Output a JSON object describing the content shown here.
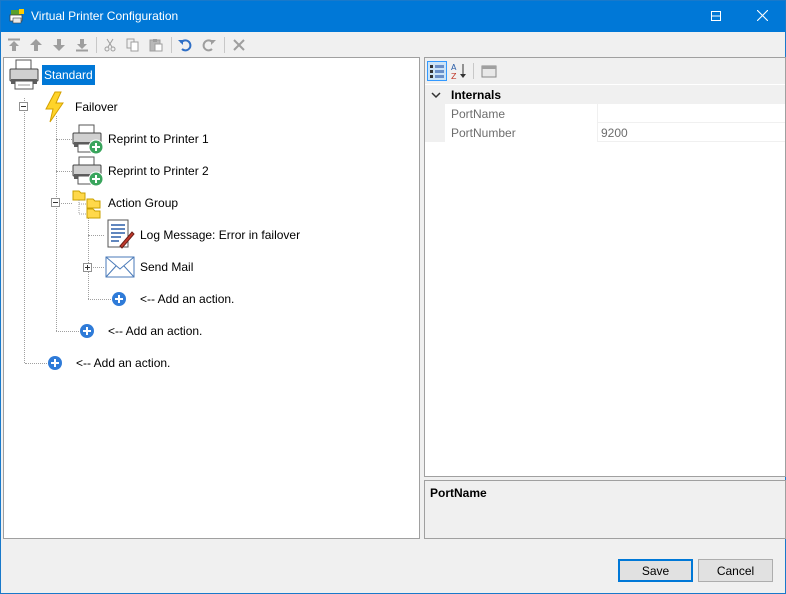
{
  "window": {
    "title": "Virtual Printer Configuration",
    "controls": [
      "minimize-icon",
      "maximize-icon",
      "close-icon"
    ]
  },
  "toolbar": {
    "items": [
      "move-top-icon",
      "move-up-icon",
      "move-down-icon",
      "move-bottom-icon",
      "cut-icon",
      "copy-icon",
      "paste-icon",
      "undo-icon",
      "redo-icon",
      "delete-icon"
    ]
  },
  "tree": {
    "root": {
      "label": "Standard",
      "icon": "printer-icon"
    },
    "failover": {
      "label": "Failover",
      "icon": "lightning-icon"
    },
    "reprint1": {
      "label": "Reprint to Printer 1",
      "icon": "printer-add-icon"
    },
    "reprint2": {
      "label": "Reprint to Printer 2",
      "icon": "printer-add-icon"
    },
    "action_group": {
      "label": "Action Group",
      "icon": "folders-icon"
    },
    "log_message": {
      "label": "Log Message: Error in failover",
      "icon": "log-document-icon"
    },
    "send_mail": {
      "label": "Send Mail",
      "icon": "envelope-icon"
    },
    "add_action_group": {
      "label": "<-- Add an action.",
      "icon": "add-circle-icon"
    },
    "add_action_failover": {
      "label": "<-- Add an action.",
      "icon": "add-circle-icon"
    },
    "add_action_root": {
      "label": "<-- Add an action.",
      "icon": "add-circle-icon"
    }
  },
  "properties": {
    "toolbar": [
      "categorized-icon",
      "alphabetical-icon",
      "property-pages-icon"
    ],
    "category": "Internals",
    "rows": [
      {
        "name": "PortName",
        "value": ""
      },
      {
        "name": "PortNumber",
        "value": "9200"
      }
    ],
    "description_title": "PortName"
  },
  "buttons": {
    "save": "Save",
    "cancel": "Cancel"
  },
  "colors": {
    "accent": "#0078d7",
    "add_icon": "#2f7bd8"
  }
}
